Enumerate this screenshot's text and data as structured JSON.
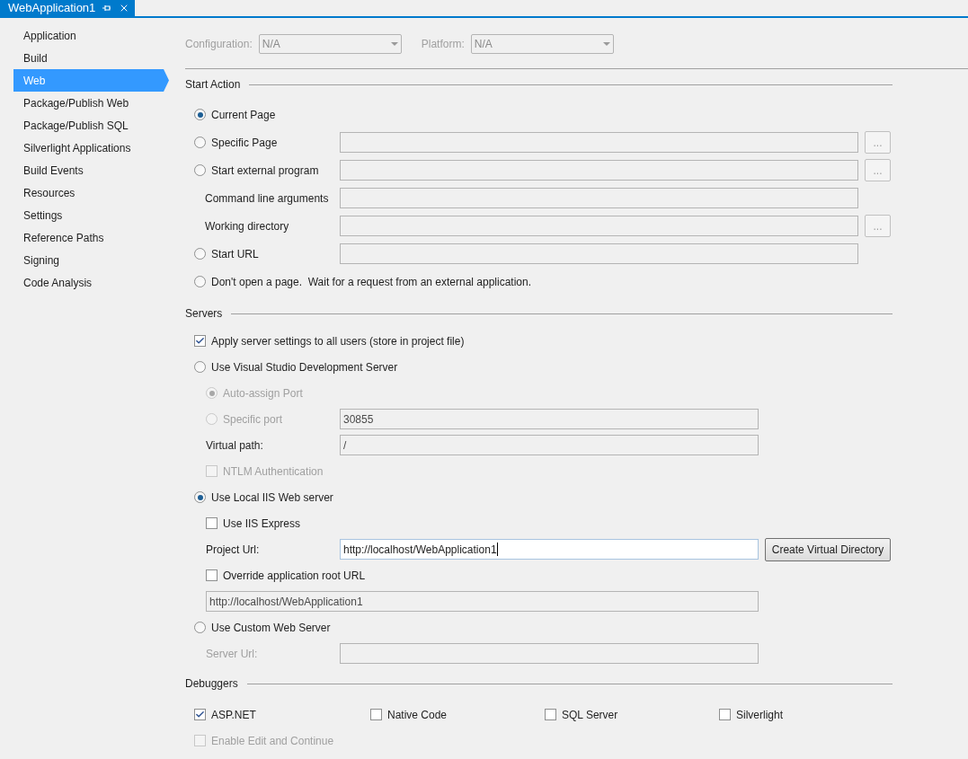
{
  "tab": {
    "title": "WebApplication1"
  },
  "sidebar": {
    "items": [
      {
        "label": "Application",
        "selected": false
      },
      {
        "label": "Build",
        "selected": false
      },
      {
        "label": "Web",
        "selected": true
      },
      {
        "label": "Package/Publish Web",
        "selected": false
      },
      {
        "label": "Package/Publish SQL",
        "selected": false
      },
      {
        "label": "Silverlight Applications",
        "selected": false
      },
      {
        "label": "Build Events",
        "selected": false
      },
      {
        "label": "Resources",
        "selected": false
      },
      {
        "label": "Settings",
        "selected": false
      },
      {
        "label": "Reference Paths",
        "selected": false
      },
      {
        "label": "Signing",
        "selected": false
      },
      {
        "label": "Code Analysis",
        "selected": false
      }
    ]
  },
  "selectors": [
    {
      "label": "Configuration:",
      "value": "N/A",
      "disabled": true
    },
    {
      "label": "Platform:",
      "value": "N/A",
      "disabled": true
    }
  ],
  "sections": [
    {
      "kind": "list",
      "title": "Start Action",
      "items": [
        {
          "kind": "radio",
          "label": "Current Page",
          "selected": true,
          "disabled": false
        },
        {
          "kind": "radio",
          "label": "Specific Page",
          "selected": false,
          "disabled": false,
          "field": {
            "disabled": true
          },
          "button": {
            "label": "...",
            "disabled": true
          }
        },
        {
          "kind": "radio",
          "label": "Start external program",
          "selected": false,
          "disabled": false,
          "field": {
            "disabled": true
          },
          "button": {
            "label": "...",
            "disabled": true
          }
        },
        {
          "kind": "label",
          "label": "Command line arguments",
          "disabled": false,
          "field": {
            "disabled": true
          }
        },
        {
          "kind": "label",
          "label": "Working directory",
          "disabled": false,
          "field": {
            "disabled": true
          },
          "button": {
            "label": "...",
            "disabled": true
          }
        },
        {
          "kind": "radio",
          "label": "Start URL",
          "selected": false,
          "disabled": false,
          "field": {
            "disabled": true
          }
        },
        {
          "kind": "radio",
          "label": "Don't open a page.  Wait for a request from an external application.",
          "selected": false,
          "disabled": false
        }
      ]
    },
    {
      "kind": "list",
      "title": "Servers",
      "items": [
        {
          "kind": "checkbox",
          "label": "Apply server settings to all users (store in project file)",
          "checked": true,
          "disabled": false
        },
        {
          "kind": "radio",
          "label": "Use Visual Studio Development Server",
          "selected": false,
          "disabled": false,
          "children": [
            {
              "kind": "radio",
              "label": "Auto-assign Port",
              "selected": true,
              "disabled": true
            },
            {
              "kind": "radio",
              "label": "Specific port",
              "selected": false,
              "disabled": true,
              "field": {
                "value": "30855",
                "disabled": true
              }
            },
            {
              "kind": "label",
              "label": "Virtual path:",
              "disabled": false,
              "field": {
                "value": "/",
                "disabled": true
              }
            },
            {
              "kind": "checkbox",
              "label": "NTLM Authentication",
              "checked": false,
              "disabled": true
            }
          ]
        },
        {
          "kind": "radio",
          "label": "Use Local IIS Web server",
          "selected": true,
          "disabled": false,
          "children": [
            {
              "kind": "checkbox",
              "label": "Use IIS Express",
              "checked": false,
              "disabled": false
            },
            {
              "kind": "label",
              "label": "Project Url:",
              "disabled": false,
              "field": {
                "value": "http://localhost/WebApplication1",
                "disabled": false,
                "focused": true
              },
              "button": {
                "label": "Create Virtual Directory",
                "disabled": false
              }
            },
            {
              "kind": "checkbox",
              "label": "Override application root URL",
              "checked": false,
              "disabled": false
            },
            {
              "kind": "field",
              "field": {
                "value": "http://localhost/WebApplication1",
                "disabled": true
              }
            }
          ]
        },
        {
          "kind": "radio",
          "label": "Use Custom Web Server",
          "selected": false,
          "disabled": false,
          "children": [
            {
              "kind": "label",
              "label": "Server Url:",
              "disabled": true,
              "field": {
                "disabled": true
              }
            }
          ]
        }
      ]
    },
    {
      "kind": "grid",
      "title": "Debuggers",
      "items": [
        {
          "kind": "checkbox",
          "label": "ASP.NET",
          "checked": true,
          "disabled": false
        },
        {
          "kind": "checkbox",
          "label": "Native Code",
          "checked": false,
          "disabled": false
        },
        {
          "kind": "checkbox",
          "label": "SQL Server",
          "checked": false,
          "disabled": false
        },
        {
          "kind": "checkbox",
          "label": "Silverlight",
          "checked": false,
          "disabled": false
        },
        {
          "kind": "checkbox",
          "label": "Enable Edit and Continue",
          "checked": false,
          "disabled": true
        }
      ]
    }
  ]
}
